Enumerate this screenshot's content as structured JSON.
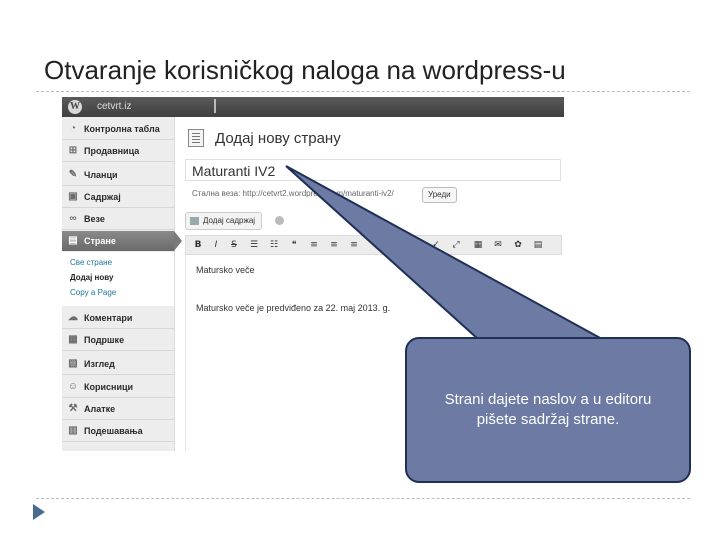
{
  "slide": {
    "title": "Otvaranje korisničkog naloga na wordpress-u"
  },
  "wp": {
    "admin_bar": {
      "logo": "W",
      "site_name": "cetvrt.iz"
    },
    "sidebar": {
      "items": [
        {
          "label": "Контролна табла",
          "icon": "dashboard-icon"
        },
        {
          "label": "Продавница",
          "icon": "cart-icon"
        },
        {
          "label": "Чланци",
          "icon": "pin-icon"
        },
        {
          "label": "Садржај",
          "icon": "media-icon"
        },
        {
          "label": "Везе",
          "icon": "link-icon"
        },
        {
          "label": "Стране",
          "icon": "pages-icon"
        },
        {
          "label": "Коментари",
          "icon": "comment-icon"
        },
        {
          "label": "Подршке",
          "icon": "support-icon"
        },
        {
          "label": "Изглед",
          "icon": "appearance-icon"
        },
        {
          "label": "Корисници",
          "icon": "users-icon"
        },
        {
          "label": "Алатке",
          "icon": "tools-icon"
        },
        {
          "label": "Подешавања",
          "icon": "settings-icon"
        }
      ],
      "submenu": [
        "Све стране",
        "Додај нову",
        "Copy a Page"
      ]
    },
    "main": {
      "heading": "Додај нову страну",
      "title_value": "Maturanti IV2",
      "permalink": "Стална веза: http://cetvrt2.wordpress.com/maturanti-iv2/",
      "edit_button": "Уреди",
      "add_media": "Додај садржај",
      "editor_lines": [
        "Matursko veče",
        "Matursko veče je predviđeno za 22. maj 2013. g."
      ]
    }
  },
  "callout": {
    "text_line1": "Strani dajete naslov a u editoru",
    "text_line2": "pišete sadržaj strane."
  }
}
